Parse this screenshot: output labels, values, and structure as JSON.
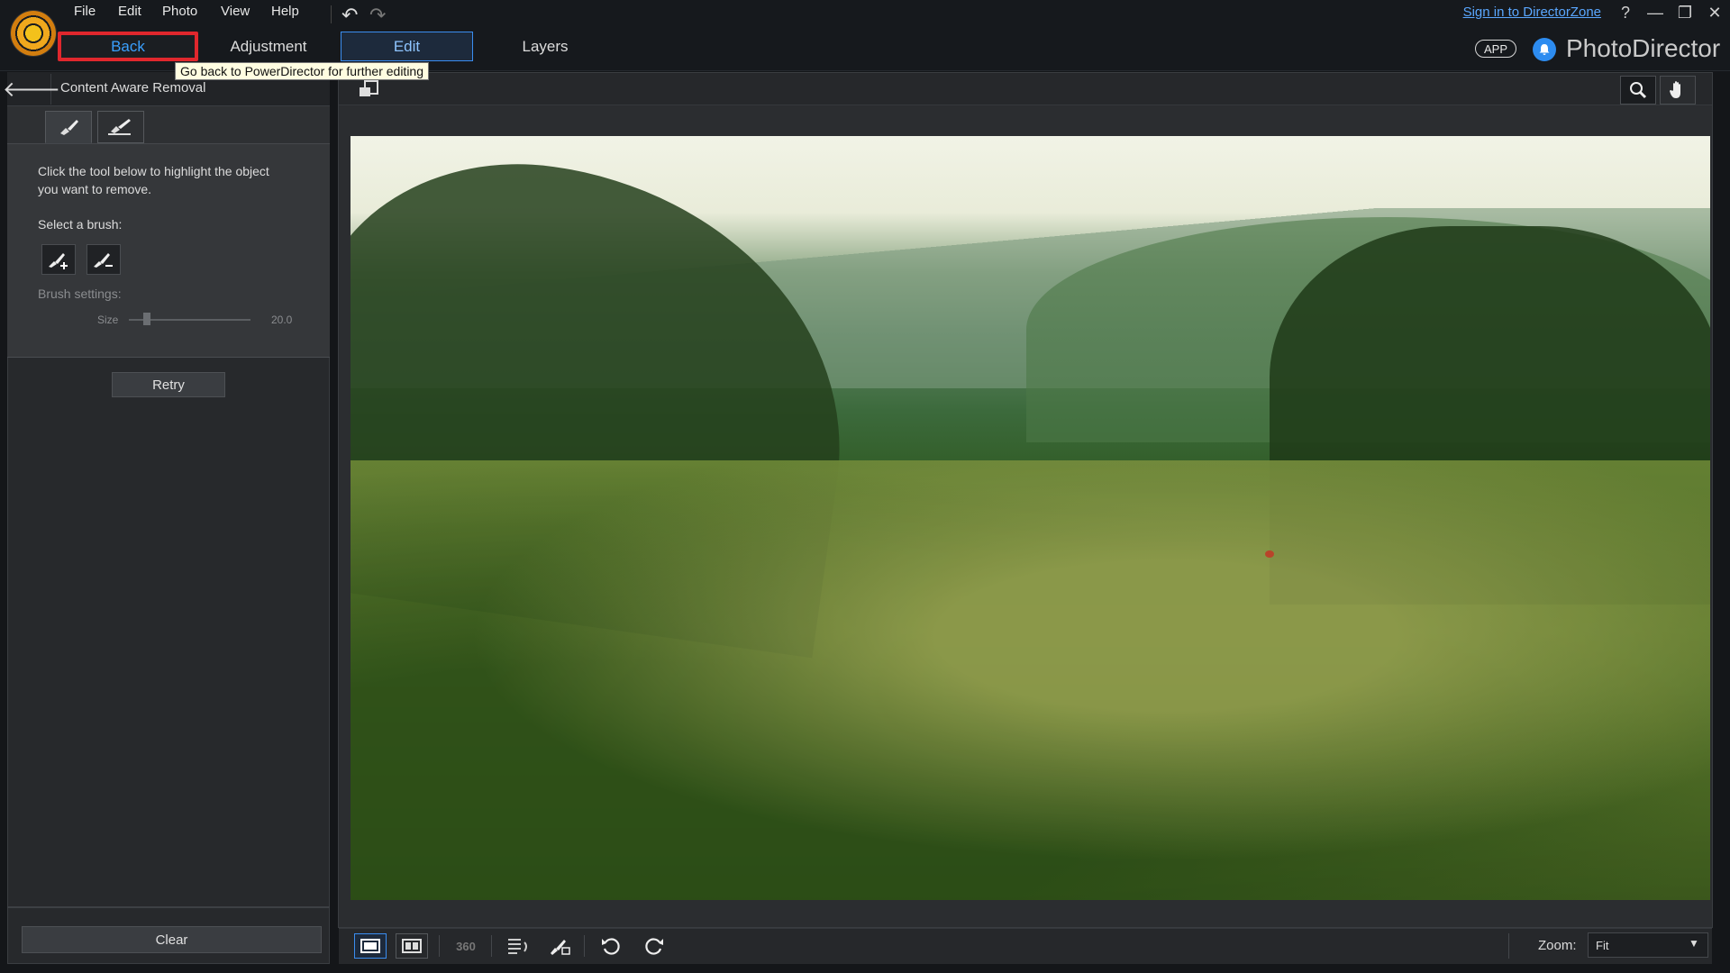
{
  "menu": [
    "File",
    "Edit",
    "Photo",
    "View",
    "Help"
  ],
  "header": {
    "sign_in": "Sign in to DirectorZone",
    "help": "?",
    "minimize": "—",
    "restore": "❐",
    "close": "✕",
    "app_badge": "APP",
    "app_name": "PhotoDirector"
  },
  "tabs": {
    "back": "Back",
    "adjustment": "Adjustment",
    "edit": "Edit",
    "layers": "Layers"
  },
  "tooltip": "Go back to PowerDirector for further editing",
  "panel": {
    "title": "Content Aware Removal",
    "instructions": "Click the tool below to highlight the object you want to remove.",
    "select_brush": "Select a brush:",
    "brush_settings": "Brush settings:",
    "size_label": "Size",
    "size_value": "20.0",
    "size_fraction": 0.15,
    "retry": "Retry",
    "clear": "Clear"
  },
  "toolbar": {
    "view_360": "360",
    "zoom_label": "Zoom:",
    "zoom_value": "Fit"
  },
  "icons": {
    "logo": "photodirector-logo",
    "undo": "undo-icon",
    "redo": "redo-icon",
    "bell": "bell-icon",
    "back_arrow": "back-arrow-icon",
    "zoom_tool": "magnifier-icon",
    "pan_tool": "hand-icon"
  },
  "colors": {
    "accent": "#3a8df0",
    "highlight": "#e0272d",
    "tooltip_bg": "#fffde1"
  }
}
